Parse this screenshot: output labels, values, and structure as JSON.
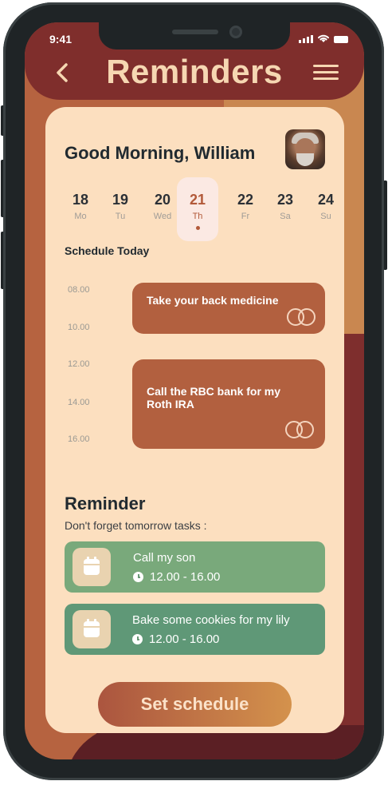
{
  "status_bar": {
    "time": "9:41"
  },
  "header": {
    "title": "Reminders"
  },
  "greeting": "Good Morning, William",
  "days": [
    {
      "num": "18",
      "wd": "Mo",
      "active": false
    },
    {
      "num": "19",
      "wd": "Tu",
      "active": false
    },
    {
      "num": "20",
      "wd": "Wed",
      "active": false
    },
    {
      "num": "21",
      "wd": "Th",
      "active": true
    },
    {
      "num": "22",
      "wd": "Fr",
      "active": false
    },
    {
      "num": "23",
      "wd": "Sa",
      "active": false
    },
    {
      "num": "24",
      "wd": "Su",
      "active": false
    }
  ],
  "schedule": {
    "title": "Schedule Today",
    "times": [
      "08.00",
      "10.00",
      "12.00",
      "14.00",
      "16.00"
    ],
    "events": [
      {
        "text": "Take your back medicine"
      },
      {
        "text": "Call the RBC bank for my Roth IRA"
      }
    ]
  },
  "reminder": {
    "title": "Reminder",
    "subtitle": "Don't forget tomorrow tasks :",
    "tasks": [
      {
        "name": "Call my son",
        "time": "12.00 - 16.00",
        "color": "#79a97b"
      },
      {
        "name": "Bake some cookies for my lily",
        "time": "12.00 - 16.00",
        "color": "#5f9877"
      }
    ]
  },
  "cta": {
    "label": "Set schedule"
  },
  "icons": [
    "back-chevron-icon",
    "menu-icon",
    "calendar-icon",
    "clock-icon",
    "rings-icon"
  ]
}
